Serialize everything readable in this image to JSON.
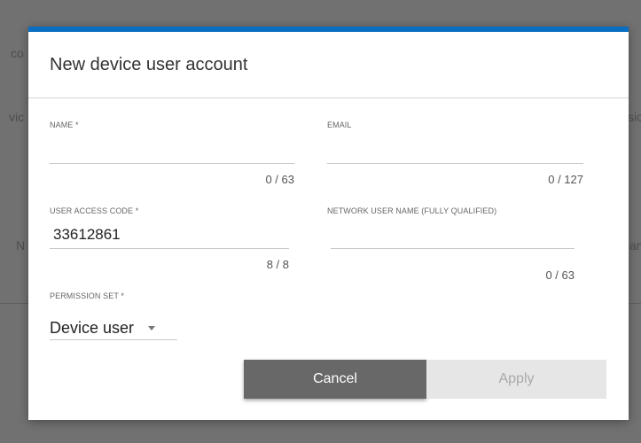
{
  "dialog": {
    "title": "New device user account",
    "accent_color": "#0a6fc2",
    "fields": {
      "name": {
        "label": "NAME *",
        "value": "",
        "counter": "0 / 63"
      },
      "email": {
        "label": "EMAIL",
        "value": "",
        "counter": "0 / 127"
      },
      "user_access_code": {
        "label": "USER ACCESS CODE *",
        "value": "33612861",
        "counter": "8 / 8"
      },
      "network_user_name": {
        "label": "NETWORK USER NAME (FULLY QUALIFIED)",
        "value": "",
        "counter": "0 / 63"
      },
      "permission_set": {
        "label": "PERMISSION SET *",
        "selected": "Device user",
        "icon": "chevron-down-icon"
      }
    },
    "buttons": {
      "cancel": "Cancel",
      "apply": "Apply"
    }
  },
  "background": {
    "fragments": [
      "co",
      "vic",
      "N",
      "sic",
      "am"
    ]
  }
}
